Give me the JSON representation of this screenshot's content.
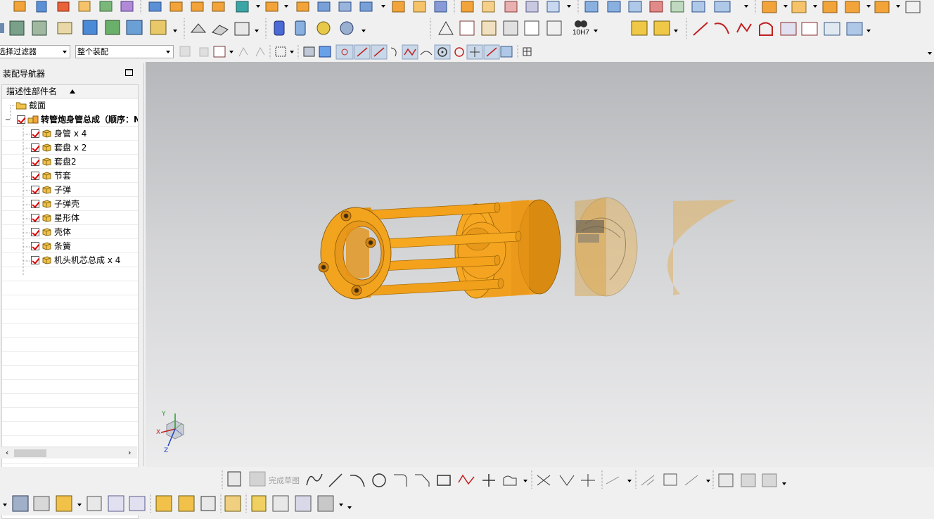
{
  "toolbar": {
    "selection_filter": "选择过滤器",
    "assembly_scope": "整个装配",
    "tolerance_label": "10H7"
  },
  "navigator": {
    "title": "装配导航器",
    "column_header": "描述性部件名",
    "items": [
      {
        "label": "截面",
        "type": "folder"
      },
      {
        "label": "转管炮身管总成（顺序：N",
        "type": "root"
      },
      {
        "label": "身管 x 4",
        "type": "part"
      },
      {
        "label": "套盘 x 2",
        "type": "part"
      },
      {
        "label": "套盘2",
        "type": "part"
      },
      {
        "label": "节套",
        "type": "part"
      },
      {
        "label": "子弹",
        "type": "part"
      },
      {
        "label": "子弹壳",
        "type": "part"
      },
      {
        "label": "星形体",
        "type": "part"
      },
      {
        "label": "壳体",
        "type": "part"
      },
      {
        "label": "条簧",
        "type": "part"
      },
      {
        "label": "机头机芯总成 x 4",
        "type": "part"
      }
    ],
    "scroll_left": "‹",
    "scroll_right": "›"
  },
  "sketch_toolbar": {
    "finish_sketch": "完成草图"
  },
  "triad": {
    "x": "X",
    "y": "Y",
    "z": "Z"
  },
  "colors": {
    "part_orange": "#f3a21b",
    "part_dark": "#c27308",
    "checkbox_red": "#dd0000",
    "viewport_top": "#b5b7ba",
    "viewport_bottom": "#ececed"
  }
}
